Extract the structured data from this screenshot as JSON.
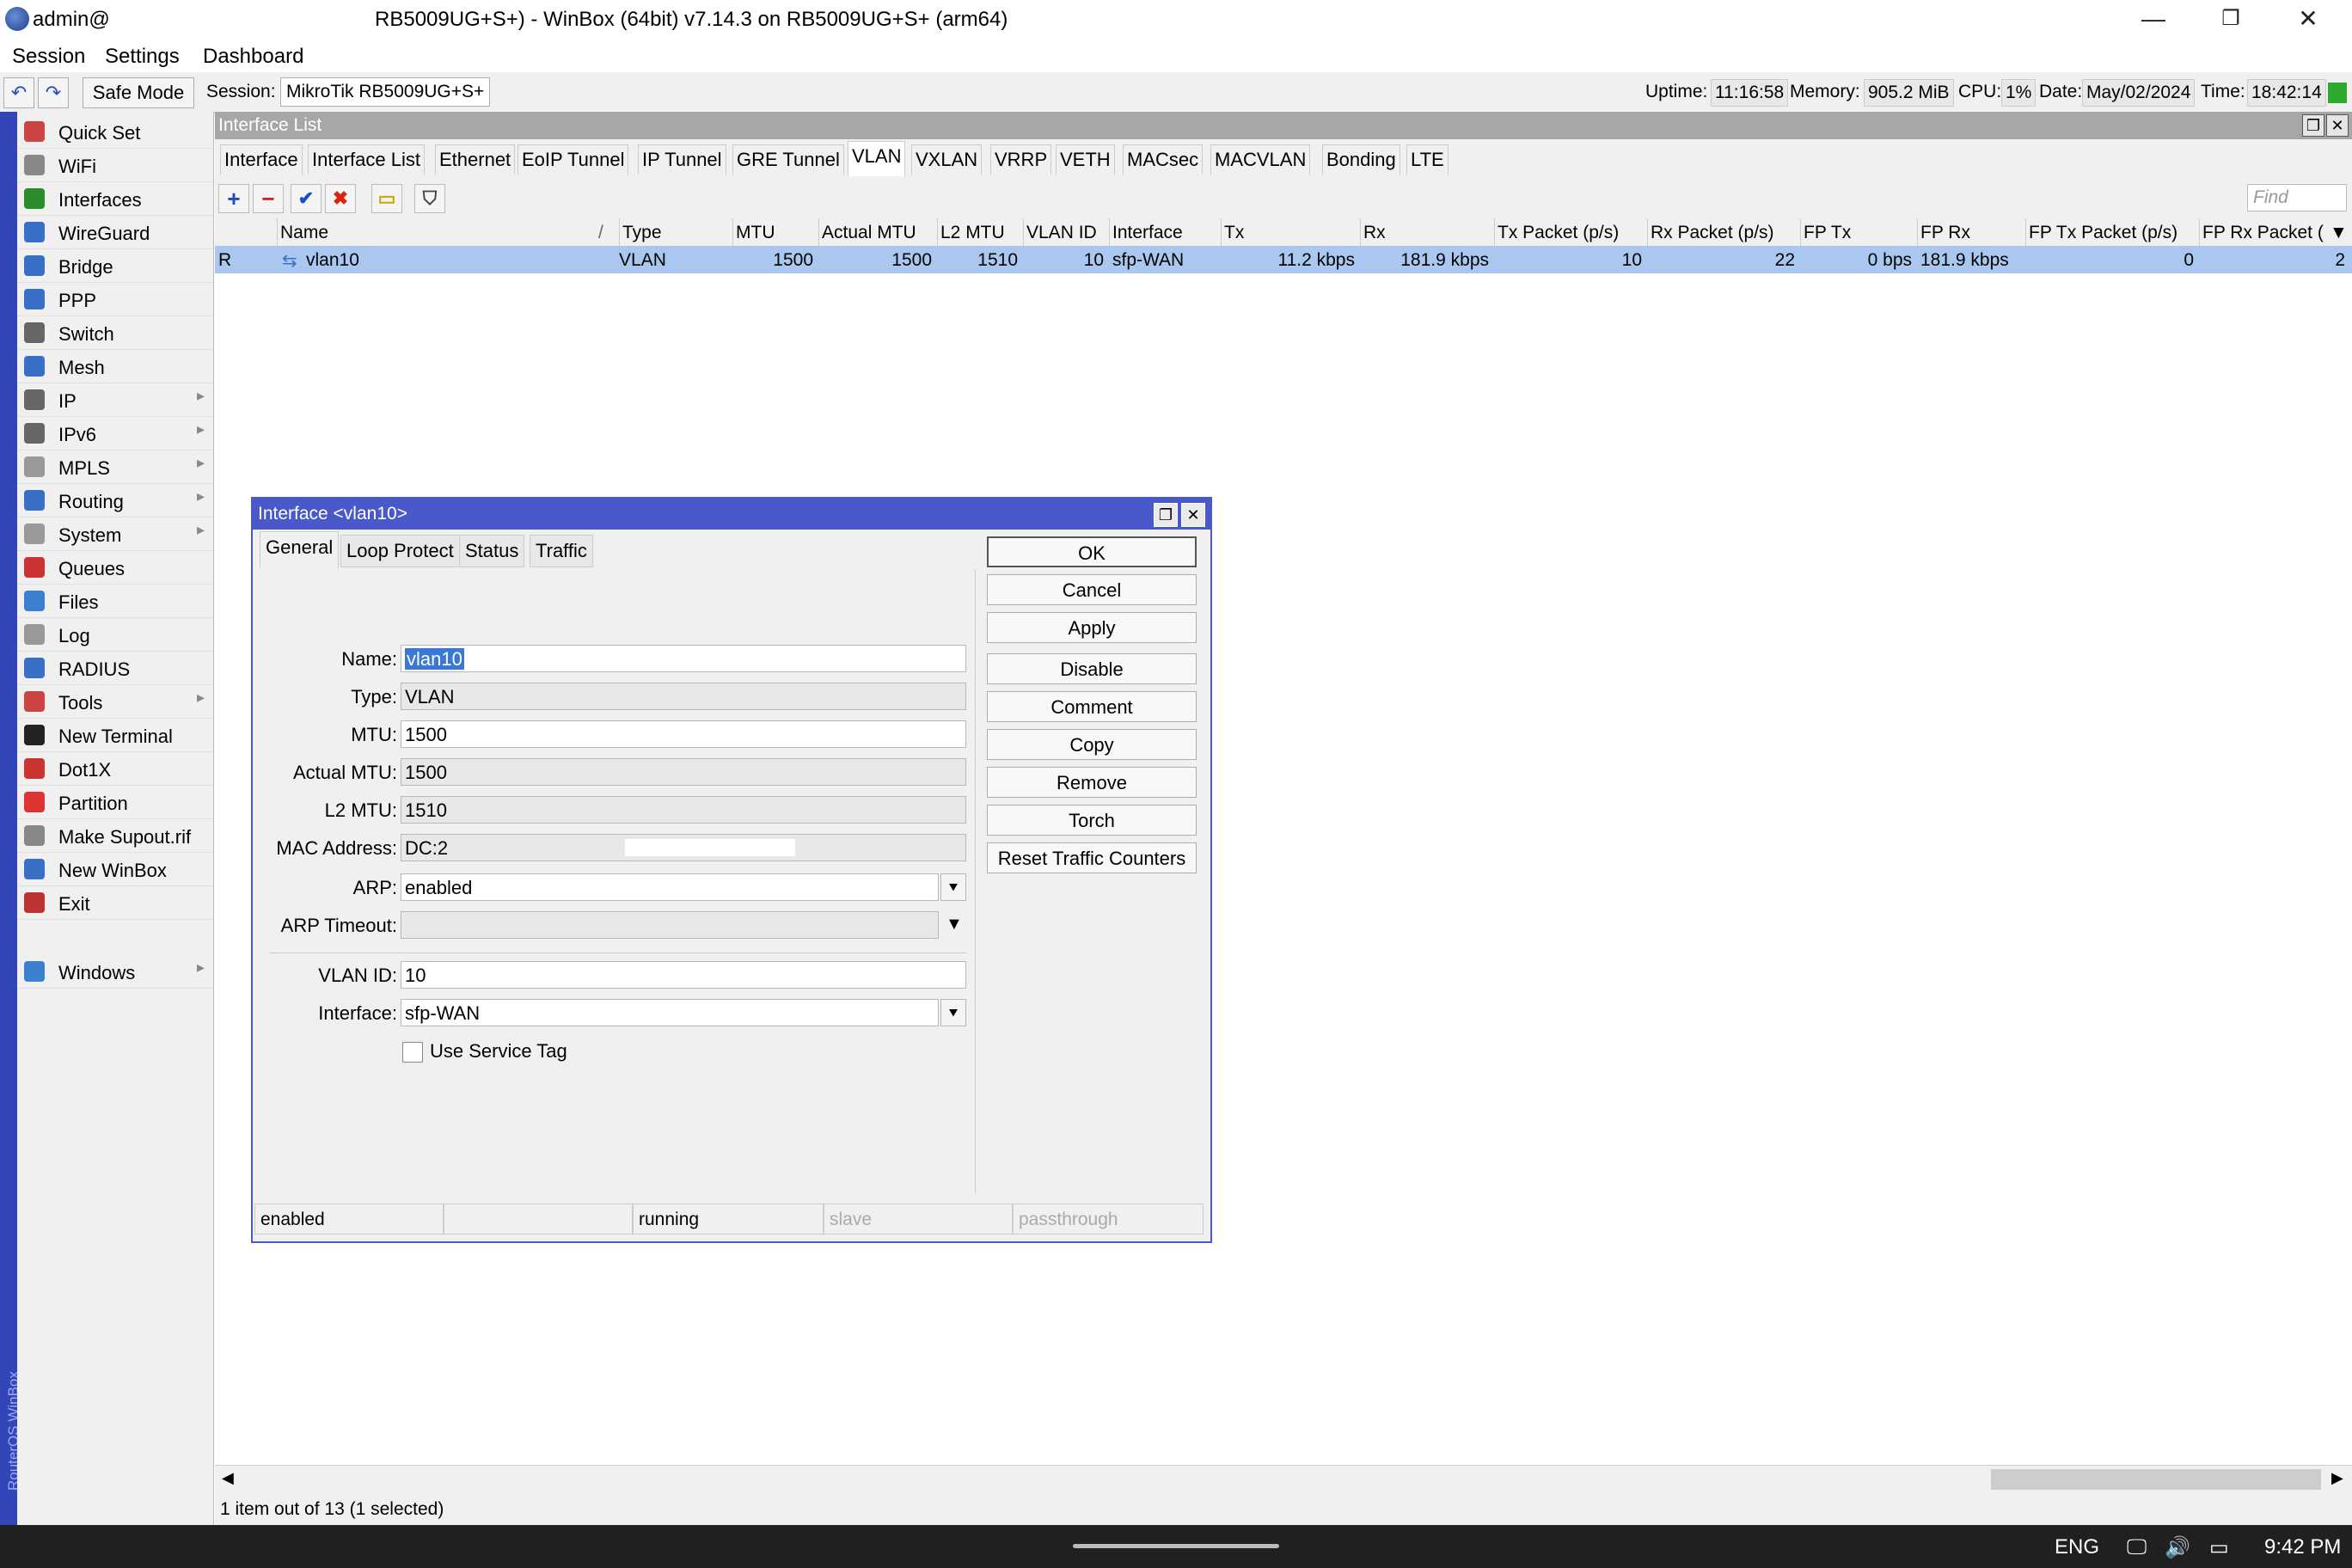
{
  "window": {
    "title_user": "admin@",
    "title_rest": "RB5009UG+S+) - WinBox (64bit) v7.14.3 on RB5009UG+S+ (arm64)",
    "minimize": "—",
    "maximize": "❐",
    "close": "✕"
  },
  "menu": [
    "Session",
    "Settings",
    "Dashboard"
  ],
  "toolbar": {
    "undo": "↶",
    "redo": "↷",
    "safe_mode": "Safe Mode",
    "session_label": "Session:",
    "session_value": "MikroTik RB5009UG+S+",
    "uptime_label": "Uptime:",
    "uptime": "11:16:58",
    "memory_label": "Memory:",
    "memory": "905.2 MiB",
    "cpu_label": "CPU:",
    "cpu": "1%",
    "date_label": "Date:",
    "date": "May/02/2024",
    "time_label": "Time:",
    "time": "18:42:14"
  },
  "brand_strip": "RouterOS WinBox",
  "sidebar": {
    "items": [
      {
        "label": "Quick Set",
        "icon": "wand-icon",
        "color": "#c44",
        "sub": false
      },
      {
        "label": "WiFi",
        "icon": "antenna-icon",
        "color": "#888",
        "sub": false
      },
      {
        "label": "Interfaces",
        "icon": "interfaces-icon",
        "color": "#2a8c2a",
        "sub": false
      },
      {
        "label": "WireGuard",
        "icon": "wireguard-icon",
        "color": "#3a6fc8",
        "sub": false
      },
      {
        "label": "Bridge",
        "icon": "bridge-icon",
        "color": "#3a6fc8",
        "sub": false
      },
      {
        "label": "PPP",
        "icon": "ppp-icon",
        "color": "#3a6fc8",
        "sub": false
      },
      {
        "label": "Switch",
        "icon": "switch-icon",
        "color": "#666",
        "sub": false
      },
      {
        "label": "Mesh",
        "icon": "mesh-icon",
        "color": "#3a6fc8",
        "sub": false
      },
      {
        "label": "IP",
        "icon": "ip-icon",
        "color": "#666",
        "sub": true
      },
      {
        "label": "IPv6",
        "icon": "ipv6-icon",
        "color": "#666",
        "sub": true
      },
      {
        "label": "MPLS",
        "icon": "mpls-icon",
        "color": "#999",
        "sub": true
      },
      {
        "label": "Routing",
        "icon": "routing-icon",
        "color": "#3a6fc8",
        "sub": true
      },
      {
        "label": "System",
        "icon": "gear-icon",
        "color": "#999",
        "sub": true
      },
      {
        "label": "Queues",
        "icon": "queues-icon",
        "color": "#c33",
        "sub": false
      },
      {
        "label": "Files",
        "icon": "folder-icon",
        "color": "#3a7fd0",
        "sub": false
      },
      {
        "label": "Log",
        "icon": "log-icon",
        "color": "#999",
        "sub": false
      },
      {
        "label": "RADIUS",
        "icon": "radius-icon",
        "color": "#3a6fc8",
        "sub": false
      },
      {
        "label": "Tools",
        "icon": "tools-icon",
        "color": "#c44",
        "sub": true
      },
      {
        "label": "New Terminal",
        "icon": "terminal-icon",
        "color": "#222",
        "sub": false
      },
      {
        "label": "Dot1X",
        "icon": "dot1x-icon",
        "color": "#c33",
        "sub": false
      },
      {
        "label": "Partition",
        "icon": "partition-icon",
        "color": "#d33",
        "sub": false
      },
      {
        "label": "Make Supout.rif",
        "icon": "supout-icon",
        "color": "#888",
        "sub": false
      },
      {
        "label": "New WinBox",
        "icon": "winbox-icon",
        "color": "#3a6fc8",
        "sub": false
      },
      {
        "label": "Exit",
        "icon": "exit-icon",
        "color": "#b33",
        "sub": false
      }
    ],
    "windows": {
      "label": "Windows",
      "icon": "windows-icon",
      "color": "#3a7fd0",
      "sub": true
    }
  },
  "interface_list": {
    "title": "Interface List",
    "tabs": [
      "Interface",
      "Interface List",
      "Ethernet",
      "EoIP Tunnel",
      "IP Tunnel",
      "GRE Tunnel",
      "VLAN",
      "VXLAN",
      "VRRP",
      "VETH",
      "MACsec",
      "MACVLAN",
      "Bonding",
      "LTE"
    ],
    "active_tab": "VLAN",
    "tools": {
      "add": "+",
      "remove": "−",
      "enable": "✔",
      "disable": "✖",
      "comment": "▭",
      "filter": "⛉"
    },
    "find_placeholder": "Find",
    "columns": [
      "Name",
      "Type",
      "MTU",
      "Actual MTU",
      "L2 MTU",
      "VLAN ID",
      "Interface",
      "Tx",
      "Rx",
      "Tx Packet (p/s)",
      "Rx Packet (p/s)",
      "FP Tx",
      "FP Rx",
      "FP Tx Packet (p/s)",
      "FP Rx Packet ("
    ],
    "sort_indicator": "/",
    "rows": [
      {
        "flag": "R",
        "name": "vlan10",
        "type": "VLAN",
        "mtu": "1500",
        "actual_mtu": "1500",
        "l2_mtu": "1510",
        "vlan_id": "10",
        "interface": "sfp-WAN",
        "tx": "11.2 kbps",
        "rx": "181.9 kbps",
        "tx_pps": "10",
        "rx_pps": "22",
        "fp_tx": "0 bps",
        "fp_rx": "181.9 kbps",
        "fp_tx_pps": "0",
        "fp_rx_pps": "2"
      }
    ],
    "status": "1 item out of 13 (1 selected)"
  },
  "dialog": {
    "title": "Interface <vlan10>",
    "tabs": [
      "General",
      "Loop Protect",
      "Status",
      "Traffic"
    ],
    "active_tab": "General",
    "fields": {
      "name_label": "Name:",
      "name": "vlan10",
      "type_label": "Type:",
      "type": "VLAN",
      "mtu_label": "MTU:",
      "mtu": "1500",
      "actual_mtu_label": "Actual MTU:",
      "actual_mtu": "1500",
      "l2_mtu_label": "L2 MTU:",
      "l2_mtu": "1510",
      "mac_label": "MAC Address:",
      "mac": "DC:2",
      "arp_label": "ARP:",
      "arp": "enabled",
      "arp_timeout_label": "ARP Timeout:",
      "arp_timeout": "",
      "vlan_id_label": "VLAN ID:",
      "vlan_id": "10",
      "interface_label": "Interface:",
      "interface": "sfp-WAN",
      "service_tag_label": "Use Service Tag"
    },
    "buttons": [
      "OK",
      "Cancel",
      "Apply",
      "Disable",
      "Comment",
      "Copy",
      "Remove",
      "Torch",
      "Reset Traffic Counters"
    ],
    "status_cells": [
      "enabled",
      "",
      "running",
      "slave",
      "passthrough"
    ]
  },
  "taskbar": {
    "lang": "ENG",
    "clock": "9:42 PM"
  }
}
